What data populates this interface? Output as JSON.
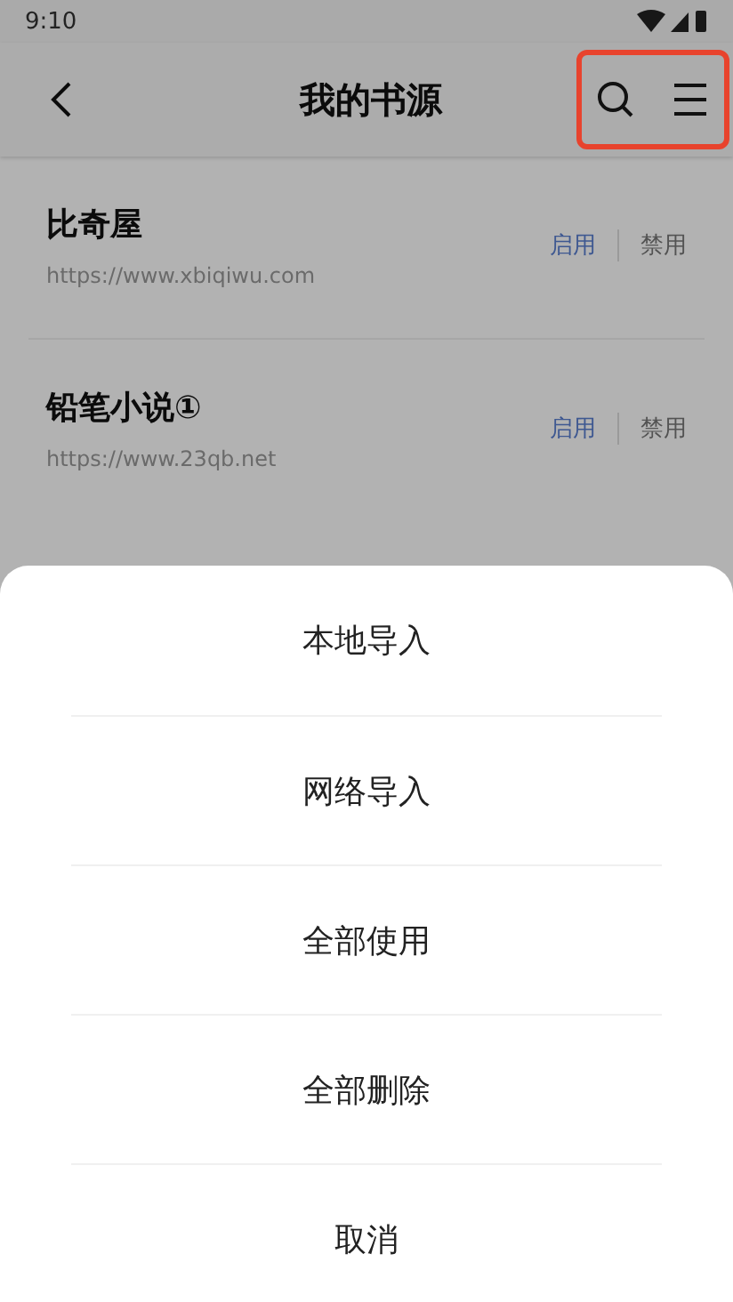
{
  "status_bar": {
    "time": "9:10"
  },
  "top_bar": {
    "title": "我的书源",
    "highlighted": true
  },
  "sources": [
    {
      "name": "比奇屋",
      "url": "https://www.xbiqiwu.com",
      "enable_label": "启用",
      "disable_label": "禁用"
    },
    {
      "name": "铅笔小说①",
      "url": "https://www.23qb.net",
      "enable_label": "启用",
      "disable_label": "禁用"
    }
  ],
  "action_sheet": {
    "items": [
      {
        "label": "本地导入",
        "divider": false
      },
      {
        "label": "网络导入",
        "divider": true
      },
      {
        "label": "全部使用",
        "divider": true
      },
      {
        "label": "全部删除",
        "divider": true
      },
      {
        "label": "取消",
        "divider": true
      }
    ]
  }
}
